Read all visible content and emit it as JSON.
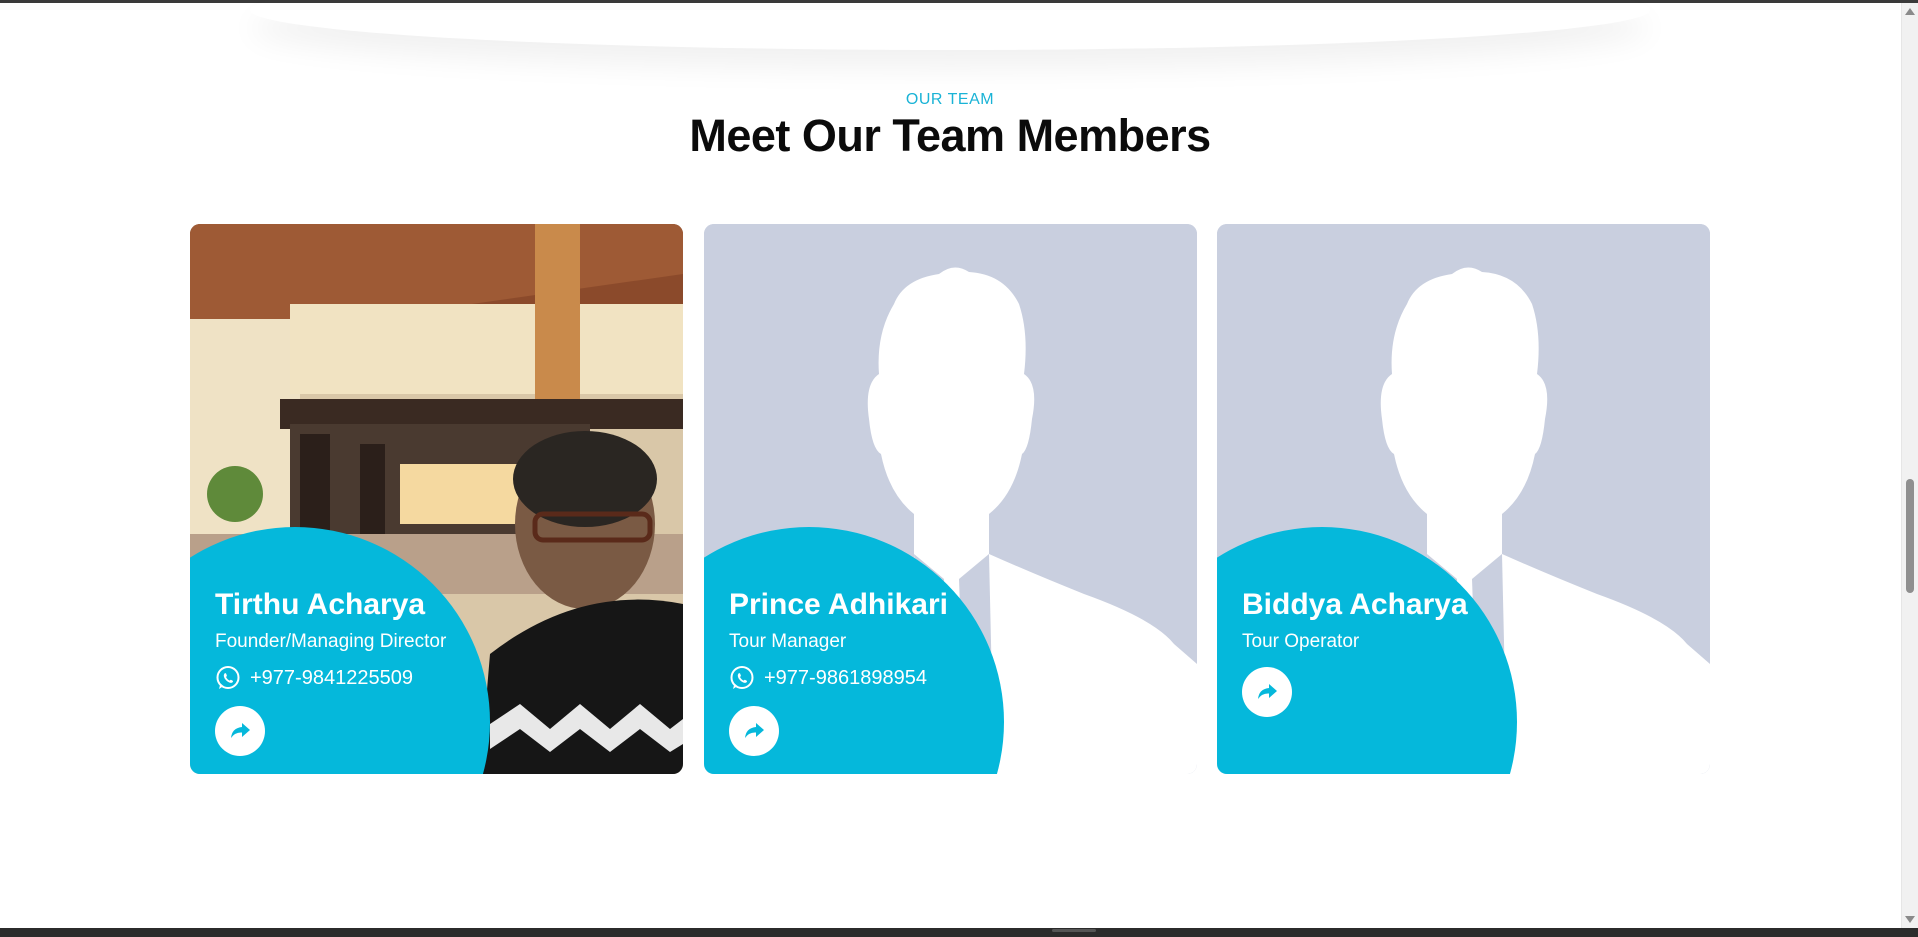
{
  "section": {
    "eyebrow": "OUR TEAM",
    "title": "Meet Our Team Members"
  },
  "colors": {
    "accent": "#05b8db",
    "placeholder_bg": "#c9cfdf",
    "heading": "#0b0b0b"
  },
  "members": [
    {
      "name": "Tirthu Acharya",
      "role": "Founder/Managing Director",
      "phone": "+977-9841225509",
      "photo": "photo",
      "icons": [
        "whatsapp-icon",
        "share-arrow-icon"
      ]
    },
    {
      "name": "Prince Adhikari",
      "role": "Tour Manager",
      "phone": "+977-9861898954",
      "photo": "placeholder-silhouette",
      "icons": [
        "whatsapp-icon",
        "share-arrow-icon"
      ]
    },
    {
      "name": "Biddya Acharya",
      "role": "Tour Operator",
      "photo": "placeholder-silhouette",
      "icons": [
        "share-arrow-icon"
      ]
    }
  ]
}
